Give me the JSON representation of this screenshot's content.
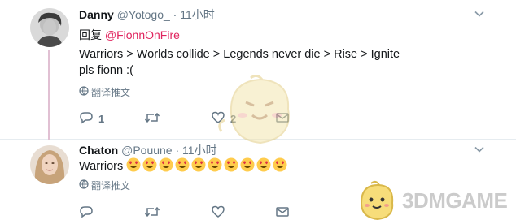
{
  "tweets": [
    {
      "name": "Danny",
      "handle": "@Yotogo_",
      "separator": "·",
      "time": "11小时",
      "reply_prefix": "回复 ",
      "reply_to": "@FionnOnFire",
      "lines": [
        "Warriors > Worlds collide > Legends never die > Rise > Ignite",
        "pls fionn :("
      ],
      "translate_label": "翻译推文",
      "reply_count": "1",
      "like_count": "2",
      "icons": {
        "avatar": "avatar-photo",
        "caret": "chevron-down-icon",
        "translate": "globe-icon",
        "reply": "reply-icon",
        "retweet": "retweet-icon",
        "like": "heart-icon",
        "message": "envelope-icon"
      }
    },
    {
      "name": "Chaton",
      "handle": "@Pouune",
      "separator": "·",
      "time": "11小时",
      "text": "Warriors",
      "emoji_name": "heart-eyes-emoji",
      "emoji_count": 10,
      "translate_label": "翻译推文",
      "icons": {
        "avatar": "avatar-photo",
        "caret": "chevron-down-icon",
        "translate": "globe-icon",
        "reply": "reply-icon",
        "retweet": "retweet-icon",
        "like": "heart-icon",
        "message": "envelope-icon"
      }
    }
  ],
  "watermark": {
    "logo_text": "3DMGAME"
  },
  "colors": {
    "mention": "#e0245e",
    "thread_line": "#e1c0d3",
    "meta": "#657786",
    "text": "#14171a"
  }
}
